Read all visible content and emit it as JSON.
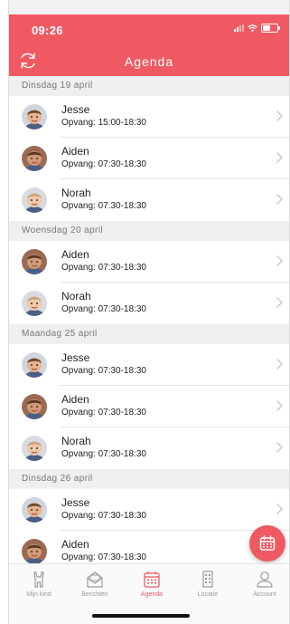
{
  "status": {
    "time": "09:26"
  },
  "header": {
    "title": "Agenda"
  },
  "colors": {
    "accent": "#ef5a62",
    "section_bg": "#efeff2"
  },
  "days": [
    {
      "label": "Dinsdag 19 april",
      "items": [
        {
          "name": "Jesse",
          "detail": "Opvang: 15:00-18:30",
          "avatar": "jesse"
        },
        {
          "name": "Aiden",
          "detail": "Opvang: 07:30-18:30",
          "avatar": "aiden"
        },
        {
          "name": "Norah",
          "detail": "Opvang: 07:30-18:30",
          "avatar": "norah"
        }
      ]
    },
    {
      "label": "Woensdag 20 april",
      "items": [
        {
          "name": "Aiden",
          "detail": "Opvang: 07:30-18:30",
          "avatar": "aiden"
        },
        {
          "name": "Norah",
          "detail": "Opvang: 07:30-18:30",
          "avatar": "norah"
        }
      ]
    },
    {
      "label": "Maandag 25 april",
      "items": [
        {
          "name": "Jesse",
          "detail": "Opvang: 07:30-18:30",
          "avatar": "jesse"
        },
        {
          "name": "Aiden",
          "detail": "Opvang: 07:30-18:30",
          "avatar": "aiden"
        },
        {
          "name": "Norah",
          "detail": "Opvang: 07:30-18:30",
          "avatar": "norah"
        }
      ]
    },
    {
      "label": "Dinsdag 26 april",
      "items": [
        {
          "name": "Jesse",
          "detail": "Opvang: 07:30-18:30",
          "avatar": "jesse"
        },
        {
          "name": "Aiden",
          "detail": "Opvang: 07:30-18:30",
          "avatar": "aiden"
        }
      ]
    }
  ],
  "tabs": [
    {
      "label": "Mijn kind",
      "icon": "child-icon",
      "active": false
    },
    {
      "label": "Berichten",
      "icon": "messages-icon",
      "active": false
    },
    {
      "label": "Agenda",
      "icon": "calendar-icon",
      "active": true
    },
    {
      "label": "Locatie",
      "icon": "building-icon",
      "active": false
    },
    {
      "label": "Account",
      "icon": "account-icon",
      "active": false
    }
  ],
  "fab": {
    "icon": "calendar-icon"
  }
}
